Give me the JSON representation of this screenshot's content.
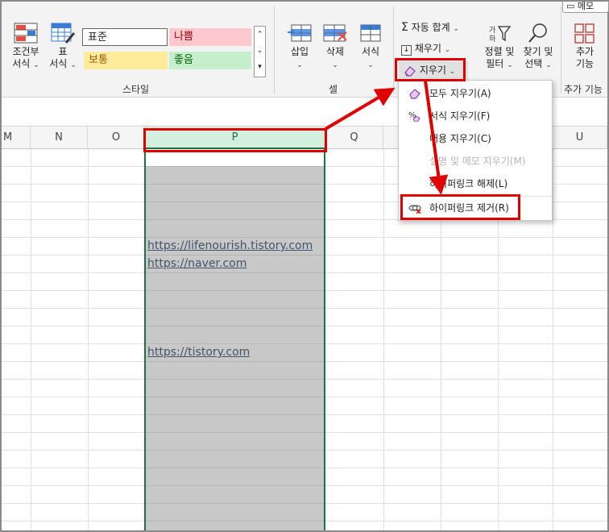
{
  "ribbon": {
    "memo_label": "메모",
    "conditional_format": {
      "line1": "조건부",
      "line2": "서식"
    },
    "table_format": {
      "line1": "표",
      "line2": "서식"
    },
    "styles": {
      "normal": "표준",
      "bad": "나쁨",
      "neutral": "보통",
      "good": "좋음",
      "group_label": "스타일"
    },
    "cells": {
      "insert": "삽입",
      "delete": "삭제",
      "format": "서식",
      "group_label": "셀"
    },
    "editing": {
      "autosum": "자동 합계",
      "fill": "채우기",
      "clear": "지우기",
      "sort_filter": {
        "line1": "정렬 및",
        "line2": "필터"
      },
      "find_select": {
        "line1": "찾기 및",
        "line2": "선택"
      }
    },
    "addins": {
      "line1": "추가",
      "line2": "기능",
      "group_label": "추가 기능"
    }
  },
  "columns": [
    "M",
    "N",
    "O",
    "P",
    "Q",
    "U"
  ],
  "cells": {
    "link1": "https://lifenourish.tistory.com",
    "link2": "https://naver.com",
    "link3": "https://tistory.com"
  },
  "clear_menu": {
    "items": [
      {
        "label": "모두 지우기(A)",
        "enabled": true
      },
      {
        "label": "서식 지우기(F)",
        "enabled": true
      },
      {
        "label": "내용 지우기(C)",
        "enabled": true
      },
      {
        "label": "설명 및 메모 지우기(M)",
        "enabled": false
      },
      {
        "label": "하이퍼링크 해제(L)",
        "enabled": true
      },
      {
        "label": "하이퍼링크 제거(R)",
        "enabled": true
      }
    ]
  },
  "colors": {
    "highlight_red": "#e00000",
    "selected_column_header": "#d3f0df",
    "selection_border": "#1e7145",
    "bad_fill": "#ffc7ce",
    "neutral_fill": "#ffeb9c",
    "good_fill": "#c6efce",
    "link_text": "#44546a"
  }
}
